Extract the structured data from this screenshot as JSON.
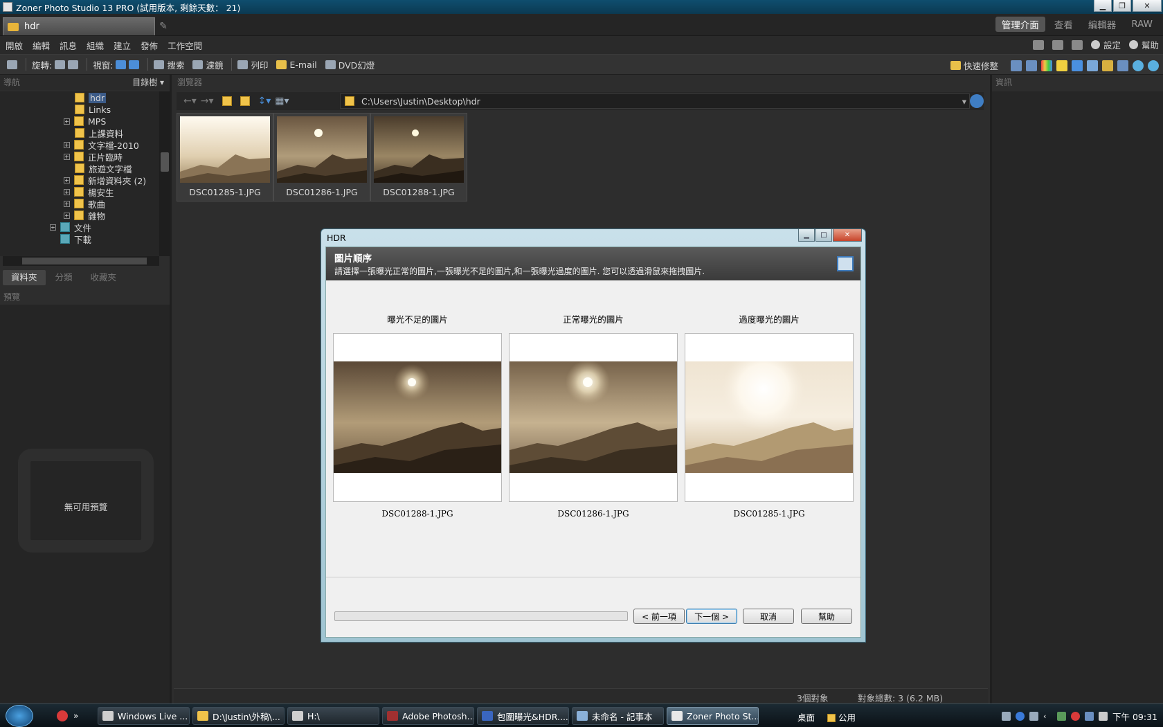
{
  "window": {
    "title": "Zoner Photo Studio 13 PRO (試用版本, 剩餘天數： 21)"
  },
  "doc_tab": {
    "label": "hdr"
  },
  "modes": [
    "管理介面",
    "查看",
    "編輯器",
    "RAW"
  ],
  "menu": [
    "開啟",
    "編輯",
    "訊息",
    "組織",
    "建立",
    "發佈",
    "工作空間"
  ],
  "menu_right": {
    "settings": "設定",
    "help": "幫助"
  },
  "toolbar": {
    "rotate": "旋轉:",
    "view": "視窗:",
    "search": "搜索",
    "filter": "濾鏡",
    "print": "列印",
    "email": "E-mail",
    "dvd": "DVD幻燈",
    "quick_fix": "快速修整"
  },
  "nav_panel": {
    "header": "導航",
    "dropdown": "目錄樹",
    "tree": [
      {
        "label": "hdr",
        "expander": ""
      },
      {
        "label": "Links",
        "expander": ""
      },
      {
        "label": "MPS",
        "expander": "+"
      },
      {
        "label": "上課資料",
        "expander": ""
      },
      {
        "label": "文字檔-2010",
        "expander": "+"
      },
      {
        "label": "正片臨時",
        "expander": "+"
      },
      {
        "label": "旅遊文字檔",
        "expander": ""
      },
      {
        "label": "新增資料夾 (2)",
        "expander": "+"
      },
      {
        "label": "楊安生",
        "expander": "+"
      },
      {
        "label": "歌曲",
        "expander": "+"
      },
      {
        "label": "雜物",
        "expander": "+"
      },
      {
        "label": "文件",
        "expander": "+"
      },
      {
        "label": "下載",
        "expander": ""
      }
    ],
    "tabs": [
      "資料夾",
      "分類",
      "收藏夾"
    ]
  },
  "preview_panel": {
    "header": "預覽",
    "empty": "無可用預覽"
  },
  "browser": {
    "header": "瀏覽器",
    "path": "C:\\Users\\Justin\\Desktop\\hdr",
    "thumbnails": [
      {
        "name": "DSC01285-1.JPG",
        "exposure": "over"
      },
      {
        "name": "DSC01286-1.JPG",
        "exposure": "normal"
      },
      {
        "name": "DSC01288-1.JPG",
        "exposure": "under"
      }
    ],
    "status": {
      "count": "3個對象",
      "total": "對象總數: 3 (6.2 MB)"
    }
  },
  "info_panel": {
    "header": "資訊"
  },
  "dialog": {
    "title": "HDR",
    "header_title": "圖片順序",
    "header_desc": "請選擇一張曝光正常的圖片,一張曝光不足的圖片,和一張曝光過度的圖片. 您可以透過滑鼠來拖拽圖片.",
    "columns": [
      {
        "label": "曝光不足的圖片",
        "file": "DSC01288-1.JPG",
        "exposure": "under"
      },
      {
        "label": "正常曝光的圖片",
        "file": "DSC01286-1.JPG",
        "exposure": "normal"
      },
      {
        "label": "過度曝光的圖片",
        "file": "DSC01285-1.JPG",
        "exposure": "over"
      }
    ],
    "buttons": {
      "prev": "< 前一項",
      "next": "下一個 >",
      "cancel": "取消",
      "help": "幫助"
    }
  },
  "taskbar": {
    "tasks": [
      "Windows Live ...",
      "D:\\Justin\\外稿\\...",
      "H:\\",
      "Adobe Photosh...",
      "包圍曝光&HDR....",
      "未命名 - 記事本",
      "Zoner Photo St..."
    ],
    "active_task": 6,
    "links": [
      "桌面",
      "公用"
    ],
    "clock": "下午 09:31"
  }
}
